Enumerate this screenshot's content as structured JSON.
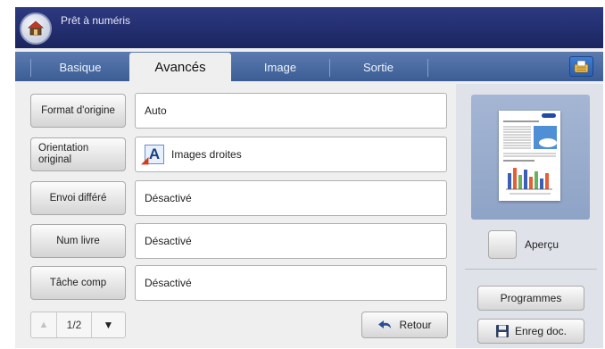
{
  "header": {
    "title": "Prêt à numéris",
    "home_icon": "home-icon"
  },
  "tabs": [
    {
      "label": "Basique",
      "active": false
    },
    {
      "label": "Avancés",
      "active": true
    },
    {
      "label": "Image",
      "active": false
    },
    {
      "label": "Sortie",
      "active": false
    }
  ],
  "options": [
    {
      "button": "Format d'origine",
      "value": "Auto"
    },
    {
      "button": "Orientation original",
      "value": "Images droites",
      "icon": "orientation-portrait-icon"
    },
    {
      "button": "Envoi différé",
      "value": "Désactivé"
    },
    {
      "button": "Num livre",
      "value": "Désactivé"
    },
    {
      "button": "Tâche comp",
      "value": "Désactivé"
    }
  ],
  "pager": {
    "indicator": "1/2"
  },
  "back_button": {
    "label": "Retour"
  },
  "right_panel": {
    "preview_label": "Aperçu",
    "programs_label": "Programmes",
    "save_doc_label": "Enreg doc."
  },
  "colors": {
    "header_bg": "#1b2560",
    "tabbar_bg": "#4a6ca3",
    "active_tab_bg": "#efefef",
    "panel_bg": "#dfe2e8"
  }
}
